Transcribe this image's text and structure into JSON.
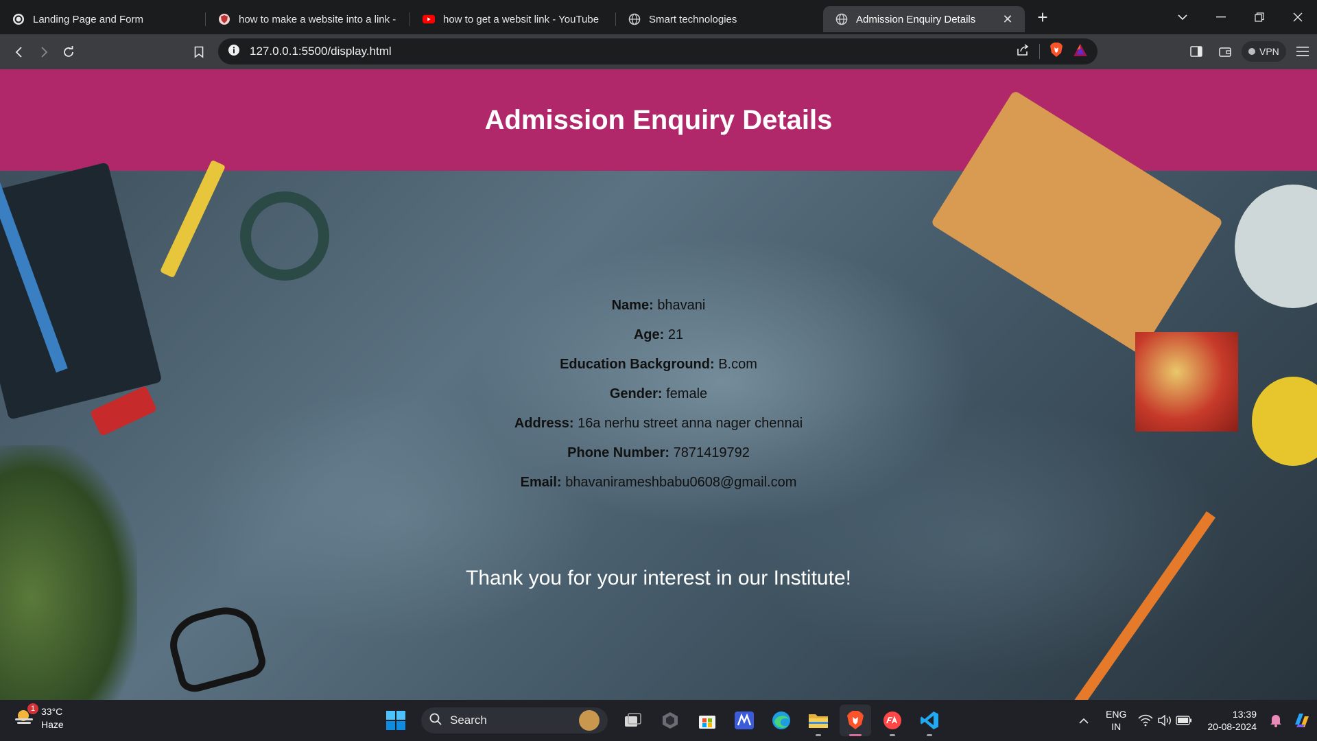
{
  "browser": {
    "tabs": [
      {
        "label": "Landing Page and Form",
        "icon": "openai-icon"
      },
      {
        "label": "how to make a website into a link -",
        "icon": "shield-icon"
      },
      {
        "label": "how to get a websit link - YouTube",
        "icon": "youtube-icon"
      },
      {
        "label": "Smart technologies",
        "icon": "globe-icon"
      },
      {
        "label": "Admission Enquiry Details",
        "icon": "globe-icon",
        "active": true
      }
    ],
    "new_tab_label": "+",
    "close_tab_label": "✕",
    "url": "127.0.0.1:5500/display.html",
    "vpn_label": "VPN"
  },
  "page": {
    "title": "Admission Enquiry Details",
    "header_color": "#b1286a",
    "fields": [
      {
        "label": "Name:",
        "value": "bhavani"
      },
      {
        "label": "Age:",
        "value": "21"
      },
      {
        "label": "Education Background:",
        "value": "B.com"
      },
      {
        "label": "Gender:",
        "value": "female"
      },
      {
        "label": "Address:",
        "value": "16a nerhu street anna nager chennai"
      },
      {
        "label": "Phone Number:",
        "value": "7871419792"
      },
      {
        "label": "Email:",
        "value": "bhavanirameshbabu0608@gmail.com"
      }
    ],
    "thank_you": "Thank you for your interest in our Institute!"
  },
  "taskbar": {
    "weather": {
      "temp": "33°C",
      "condition": "Haze",
      "badge": "1"
    },
    "search_label": "Search",
    "language": {
      "line1": "ENG",
      "line2": "IN"
    },
    "clock": {
      "time": "13:39",
      "date": "20-08-2024"
    }
  }
}
